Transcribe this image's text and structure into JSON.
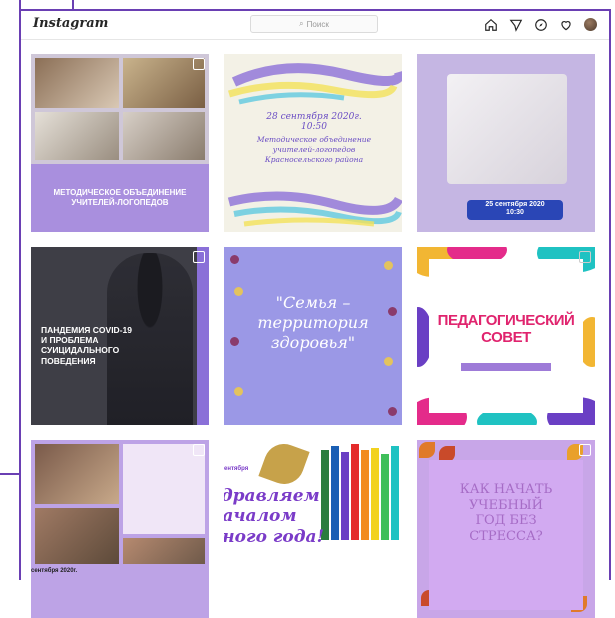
{
  "header": {
    "logo": "Instagram",
    "search_placeholder": "Поиск",
    "icons": [
      "home-icon",
      "direct-icon",
      "explore-icon",
      "heart-icon",
      "avatar"
    ]
  },
  "posts": [
    {
      "caption": "МЕТОДИЧЕСКОЕ ОБЪЕДИНЕНИЕ\nУЧИТЕЛЕЙ-ЛОГОПЕДОВ"
    },
    {
      "date": "28 сентября 2020г.\n10:50",
      "text": "Методическое объединение\nучителей-логопедов\nКрасносельского района"
    },
    {
      "badge": "25 сентября 2020\n10:30"
    },
    {
      "title": "ПАНДЕМИЯ COVID-19\nИ ПРОБЛЕМА\nСУИЦИДАЛЬНОГО\nПОВЕДЕНИЯ"
    },
    {
      "title": "\"Семья –\nтерритория\nздоровья\""
    },
    {
      "title": "ПЕДАГОГИЧЕСКИЙ\nСОВЕТ"
    },
    {
      "foot": "сентября 2020г."
    },
    {
      "tag": "ентября",
      "title": "здравляем\nначалом\nбного года!"
    },
    {
      "title": "КАК НАЧАТЬ\nУЧЕБНЫЙ\nГОД БЕЗ\nСТРЕССА?"
    }
  ],
  "colors": {
    "frame": "#6a3fb3",
    "accent_purple": "#a98fde",
    "badge_blue": "#2a46b6",
    "pink_title": "#e0246e"
  }
}
